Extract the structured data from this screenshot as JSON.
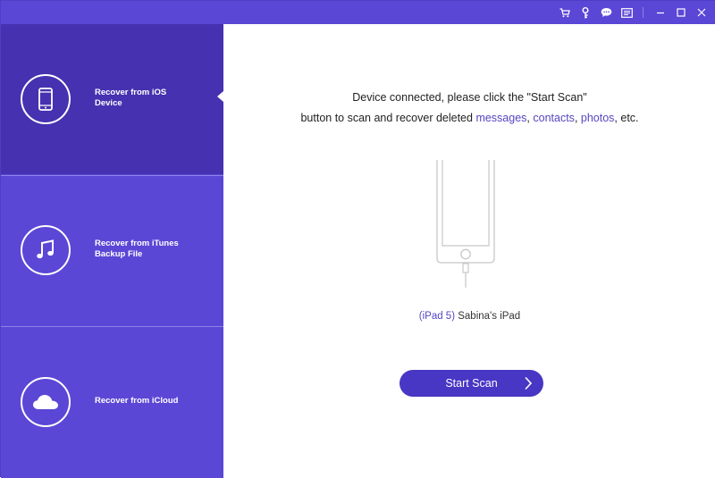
{
  "titlebar": {
    "icons": [
      "cart-icon",
      "key-icon",
      "chat-icon",
      "menu-icon",
      "minimize-icon",
      "maximize-icon",
      "close-icon"
    ]
  },
  "sidebar": {
    "items": [
      {
        "label_line1": "Recover from iOS",
        "label_line2": "Device",
        "icon": "phone-icon",
        "active": true
      },
      {
        "label_line1": "Recover from iTunes",
        "label_line2": "Backup File",
        "icon": "music-note-icon",
        "active": false
      },
      {
        "label_line1": "Recover from iCloud",
        "label_line2": "",
        "icon": "cloud-icon",
        "active": false
      }
    ]
  },
  "main": {
    "message_line1": "Device connected, please click the \"Start Scan\"",
    "message_line2_prefix": "button to scan and recover deleted ",
    "link_messages": "messages",
    "sep1": ", ",
    "link_contacts": "contacts",
    "sep2": ", ",
    "link_photos": "photos",
    "message_suffix": ", etc.",
    "device_model": "(iPad 5)",
    "device_name": " Sabina's iPad",
    "start_button_label": "Start Scan"
  },
  "colors": {
    "accent": "#5a47d6",
    "active_item": "#4631b0",
    "button": "#4836c4",
    "link": "#5546c2"
  }
}
